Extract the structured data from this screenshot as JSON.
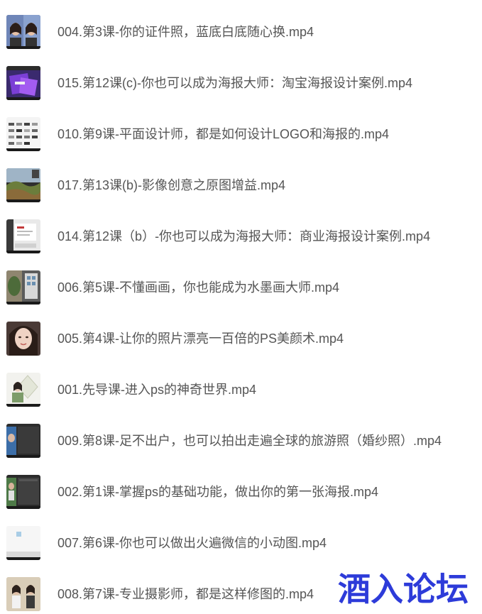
{
  "files": [
    {
      "name": "004.第3课-你的证件照，蓝底白底随心换.mp4",
      "thumbnail": "id-photo-thumbnail"
    },
    {
      "name": "015.第12课(c)-你也可以成为海报大师：淘宝海报设计案例.mp4",
      "thumbnail": "taobao-poster-thumbnail"
    },
    {
      "name": "010.第9课-平面设计师，都是如何设计LOGO和海报的.mp4",
      "thumbnail": "logo-grid-thumbnail"
    },
    {
      "name": "017.第13课(b)-影像创意之原图增益.mp4",
      "thumbnail": "landscape-thumbnail"
    },
    {
      "name": "014.第12课（b）-你也可以成为海报大师：商业海报设计案例.mp4",
      "thumbnail": "commercial-poster-thumbnail"
    },
    {
      "name": "006.第5课-不懂画画，你也能成为水墨画大师.mp4",
      "thumbnail": "ink-painting-thumbnail"
    },
    {
      "name": "005.第4课-让你的照片漂亮一百倍的PS美颜术.mp4",
      "thumbnail": "portrait-thumbnail"
    },
    {
      "name": "001.先导课-进入ps的神奇世界.mp4",
      "thumbnail": "intro-thumbnail"
    },
    {
      "name": "009.第8课-足不出户，也可以拍出走遍全球的旅游照（婚纱照）.mp4",
      "thumbnail": "travel-photo-thumbnail"
    },
    {
      "name": "002.第1课-掌握ps的基础功能，做出你的第一张海报.mp4",
      "thumbnail": "basics-thumbnail"
    },
    {
      "name": "007.第6课-你也可以做出火遍微信的小动图.mp4",
      "thumbnail": "gif-thumbnail"
    },
    {
      "name": "008.第7课-专业摄影师，都是这样修图的.mp4",
      "thumbnail": "retouch-thumbnail"
    }
  ],
  "watermark": {
    "text": "酒入论坛",
    "color": "#2d3bd9"
  }
}
